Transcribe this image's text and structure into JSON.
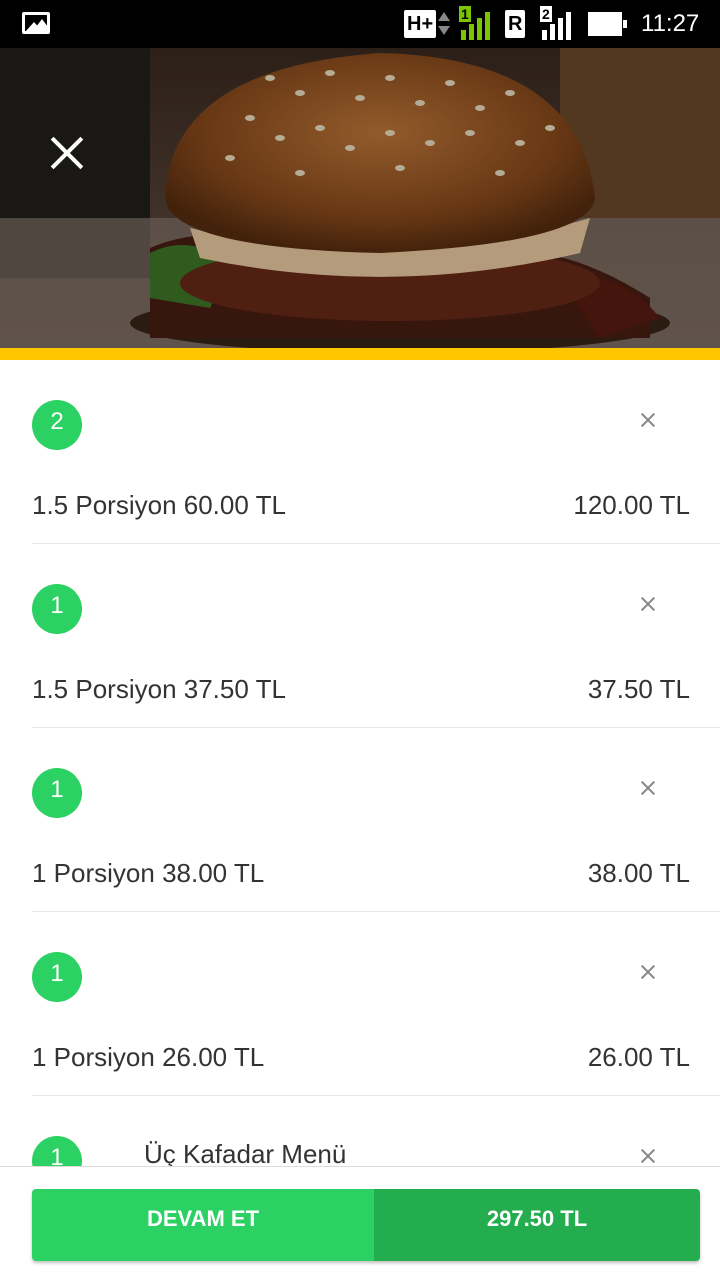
{
  "status_bar": {
    "network_type": "H+",
    "sim1_label": "1",
    "roaming_label": "R",
    "sim2_label": "2",
    "time": "11:27",
    "gallery_icon": "image-icon",
    "battery_icon": "battery-icon"
  },
  "hero": {
    "image": "burger-photo",
    "close_icon": "close-icon"
  },
  "colors": {
    "accent": "#ffc600",
    "badge": "#2bd162",
    "button_primary": "#2bd162",
    "button_total": "#23ad4f"
  },
  "cart": {
    "items": [
      {
        "quantity": "2",
        "name": "",
        "portion": "1.5 Porsiyon 60.00 TL",
        "total": "120.00 TL"
      },
      {
        "quantity": "1",
        "name": "",
        "portion": "1.5 Porsiyon 37.50 TL",
        "total": "37.50 TL"
      },
      {
        "quantity": "1",
        "name": "",
        "portion": "1 Porsiyon 38.00 TL",
        "total": "38.00 TL"
      },
      {
        "quantity": "1",
        "name": "",
        "portion": "1 Porsiyon 26.00 TL",
        "total": "26.00 TL"
      },
      {
        "quantity": "1",
        "name": "Üç Kafadar Menü",
        "portion": "",
        "total": ""
      }
    ]
  },
  "footer": {
    "continue_label": "DEVAM ET",
    "total_label": "297.50 TL"
  }
}
